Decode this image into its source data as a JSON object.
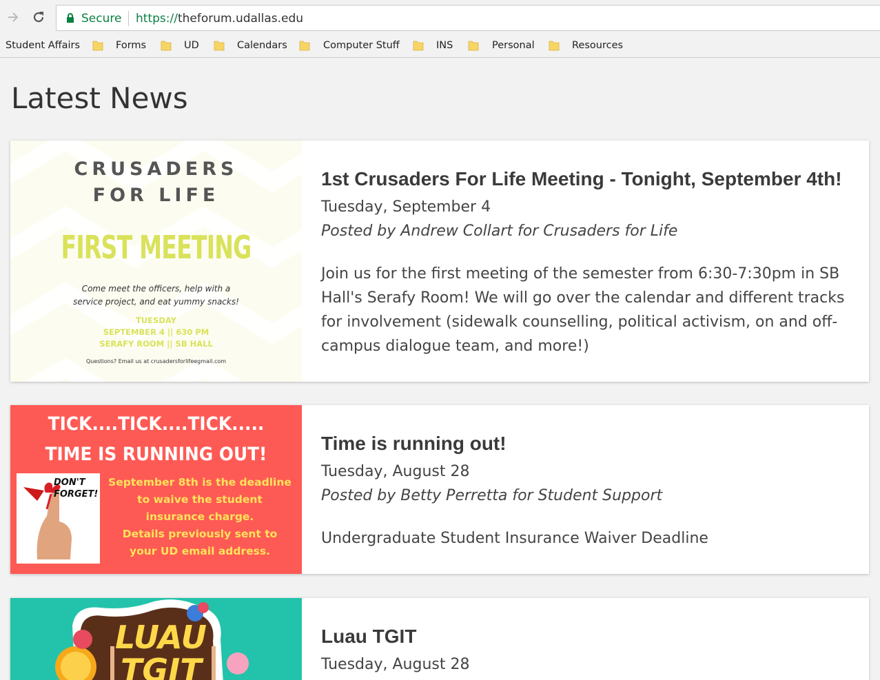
{
  "browser": {
    "secure_label": "Secure",
    "url_scheme": "https://",
    "url_host": "theforum.udallas.edu",
    "bookmarks": [
      "Student Affairs",
      "Forms",
      "UD",
      "Calendars",
      "Computer Stuff",
      "INS",
      "Personal",
      "Resources"
    ]
  },
  "page": {
    "title": "Latest News"
  },
  "news": [
    {
      "title": "1st Crusaders For Life Meeting - Tonight, September 4th!",
      "date": "Tuesday, September 4",
      "author": "Posted by Andrew Collart for Crusaders for Life",
      "summary": "Join us for the first meeting of the semester from 6:30-7:30pm in SB Hall's Serafy Room! We will go over the calendar and different tracks for involvement (sidewalk counselling, political activism, on and off-campus dialogue team, and more!)",
      "image": {
        "line1": "CRUSADERS",
        "line2": "FOR LIFE",
        "headline": "FIRST MEETING",
        "blurb1": "Come meet the officers, help with a",
        "blurb2": "service project, and eat yummy snacks!",
        "detail1": "TUESDAY",
        "detail2": "SEPTEMBER 4 || 630 PM",
        "detail3": "SERAFY ROOM || SB HALL",
        "contact": "Questions? Email us at crusadersforlifeegmail.com"
      }
    },
    {
      "title": "Time is running out!",
      "date": "Tuesday, August 28",
      "author": "Posted by Betty Perretta for Student Support",
      "summary": "Undergraduate Student Insurance Waiver Deadline",
      "image": {
        "line1": "TICK....TICK....TICK.....",
        "line2": "TIME IS RUNNING OUT!",
        "dont1": "DON'T",
        "dont2": "FORGET!",
        "msg": [
          "September 8th is the deadline",
          "to waive the student",
          "insurance charge.",
          "Details previously sent to",
          "your UD email address."
        ]
      }
    },
    {
      "title": "Luau TGIT",
      "date": "Tuesday, August 28",
      "image": {
        "line1": "LUAU",
        "line2": "TGIT"
      }
    }
  ],
  "colors": {
    "secure_green": "#0b8043",
    "card1_accent": "#d9e25a",
    "card2_bg": "#fe5a55",
    "card2_text": "#ffe35a",
    "card3_bg": "#22c3aa",
    "card3_text": "#ffd84a"
  }
}
